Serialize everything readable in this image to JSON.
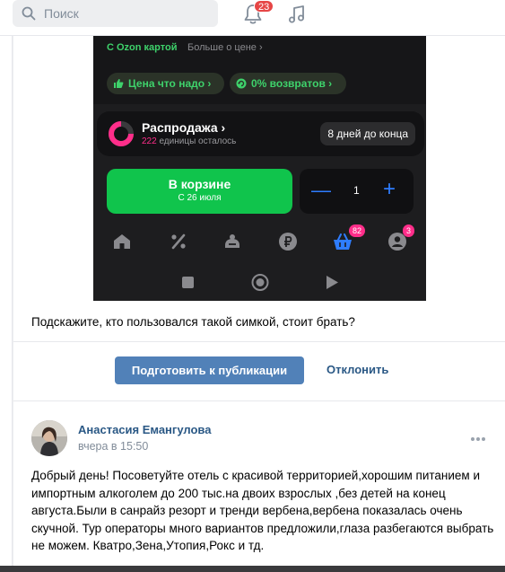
{
  "topbar": {
    "search_placeholder": "Поиск",
    "notifications_count": "23"
  },
  "product": {
    "ozon_card": "С Ozon картой",
    "more_price": "Больше о цене ›",
    "pill_price": "Цена что надо ›",
    "pill_returns": "0% возвратов ›",
    "sale_title": "Распродажа ›",
    "sale_count": "222",
    "sale_units": "единицы осталось",
    "sale_days": "8 дней до конца",
    "cart_label": "В корзине",
    "cart_date": "С 26 июля",
    "qty_minus": "—",
    "qty_value": "1",
    "qty_plus": "+",
    "cart_badge": "82",
    "profile_badge": "3"
  },
  "post1": {
    "question": "Подскажите, кто пользовался такой симкой, стоит брать?",
    "prepare_button": "Подготовить к публикации",
    "decline_button": "Отклонить"
  },
  "post2": {
    "author": "Анастасия Емангулова",
    "time": "вчера в 15:50",
    "text": "Добрый день! Посоветуйте отель с красивой территорией,хорошим питанием и импортным алкоголем до 200 тыс.на двоих взрослых ,без детей на конец августа.Были в санрайз резорт и тренди вербена,вербена показалась очень скучной. Тур операторы много вариантов предложили,глаза разбегаются выбрать не можем. Кватро,Зена,Утопия,Рокс и тд."
  },
  "colors": {
    "accent": "#5181b8",
    "link": "#2a5885",
    "ozon_green": "#10c44c",
    "badge_red": "#e64646",
    "badge_pink": "#ff2e8a"
  }
}
